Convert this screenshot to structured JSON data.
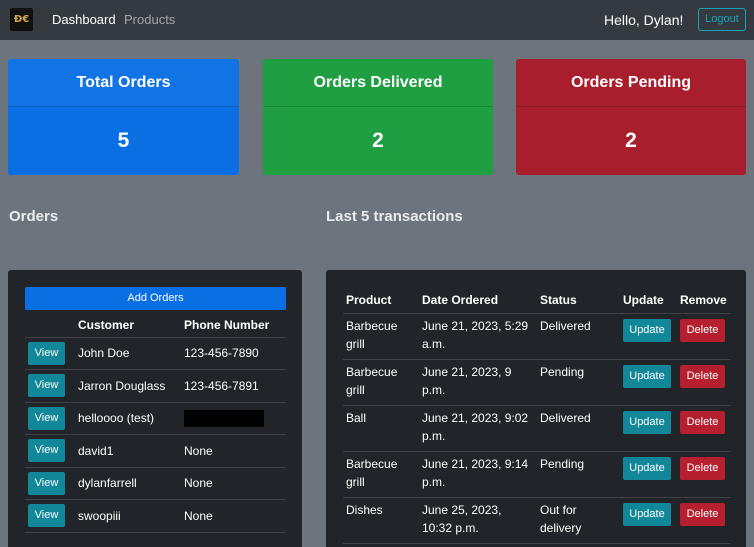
{
  "navbar": {
    "logo_text": "Ð€",
    "dashboard": "Dashboard",
    "products": "Products",
    "greeting": "Hello, Dylan!",
    "logout": "Logout"
  },
  "stats": {
    "total": {
      "title": "Total Orders",
      "value": "5"
    },
    "delivered": {
      "title": "Orders Delivered",
      "value": "2"
    },
    "pending": {
      "title": "Orders Pending",
      "value": "2"
    }
  },
  "sections": {
    "orders": "Orders",
    "transactions": "Last 5 transactions"
  },
  "orders": {
    "add_label": "Add Orders",
    "headers": [
      "",
      "Customer",
      "Phone Number"
    ],
    "view_label": "View",
    "rows": [
      {
        "customer": "John Doe",
        "phone": "123-456-7890"
      },
      {
        "customer": "Jarron Douglass",
        "phone": "123-456-7891"
      },
      {
        "customer": "helloooo (test)",
        "phone": ""
      },
      {
        "customer": "david1",
        "phone": "None"
      },
      {
        "customer": "dylanfarrell",
        "phone": "None"
      },
      {
        "customer": "swoopiii",
        "phone": "None"
      }
    ]
  },
  "transactions": {
    "headers": [
      "Product",
      "Date Ordered",
      "Status",
      "Update",
      "Remove"
    ],
    "update_label": "Update",
    "delete_label": "Delete",
    "rows": [
      {
        "product": "Barbecue grill",
        "date": "June 21, 2023, 5:29 a.m.",
        "status": "Delivered"
      },
      {
        "product": "Barbecue grill",
        "date": "June 21, 2023, 9 p.m.",
        "status": "Pending"
      },
      {
        "product": "Ball",
        "date": "June 21, 2023, 9:02 p.m.",
        "status": "Delivered"
      },
      {
        "product": "Barbecue grill",
        "date": "June 21, 2023, 9:14 p.m.",
        "status": "Pending"
      },
      {
        "product": "Dishes",
        "date": "June 25, 2023, 10:32 p.m.",
        "status": "Out for delivery"
      }
    ]
  },
  "colors": {
    "page_bg": "#6c757d",
    "navbar_bg": "#343a40",
    "primary": "#0b6fe4",
    "success": "#1f9e42",
    "danger": "#a91e2c",
    "info": "#12879a",
    "panel_bg": "#212529"
  }
}
